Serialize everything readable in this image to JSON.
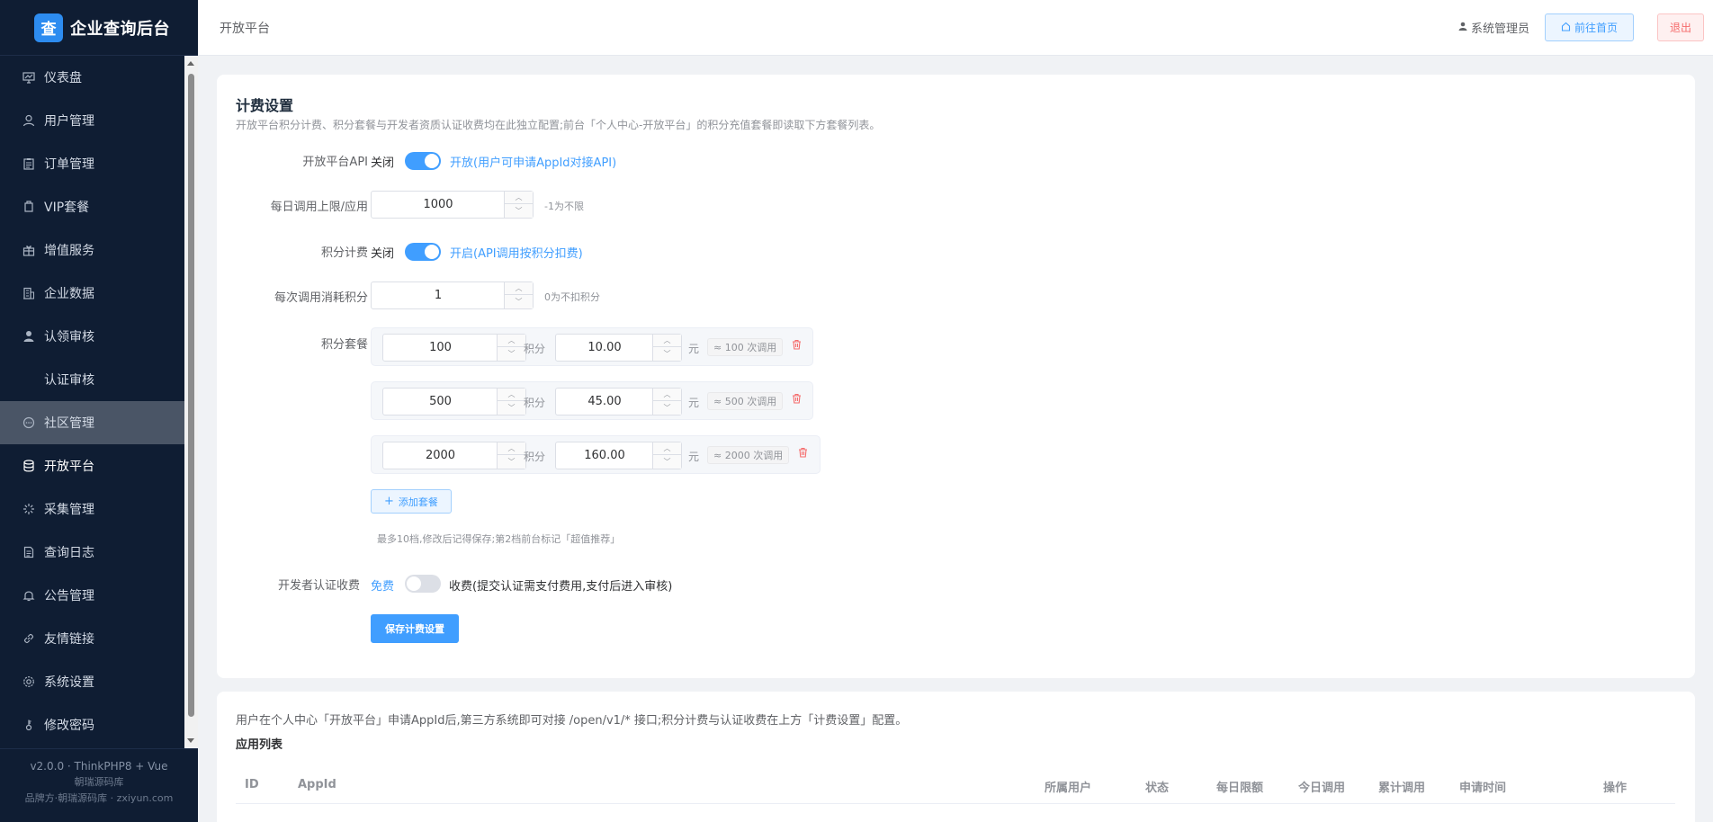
{
  "sidebar": {
    "brand_logo": "查",
    "brand_title": "企业查询后台",
    "items": [
      {
        "label": "仪表盘",
        "icon": "dashboard-icon"
      },
      {
        "label": "用户管理",
        "icon": "user-icon"
      },
      {
        "label": "订单管理",
        "icon": "order-icon"
      },
      {
        "label": "VIP套餐",
        "icon": "vip-icon"
      },
      {
        "label": "增值服务",
        "icon": "gift-icon"
      },
      {
        "label": "企业数据",
        "icon": "building-icon"
      },
      {
        "label": "认领审核",
        "icon": "user-check-icon"
      },
      {
        "label": "认证审核",
        "icon": ""
      },
      {
        "label": "社区管理",
        "icon": "chat-icon"
      },
      {
        "label": "开放平台",
        "icon": "database-icon"
      },
      {
        "label": "采集管理",
        "icon": "spinner-icon"
      },
      {
        "label": "查询日志",
        "icon": "document-icon"
      },
      {
        "label": "公告管理",
        "icon": "bell-icon"
      },
      {
        "label": "友情链接",
        "icon": "link-icon"
      },
      {
        "label": "系统设置",
        "icon": "gear-icon"
      },
      {
        "label": "修改密码",
        "icon": "key-icon"
      }
    ],
    "footer": {
      "version": "v2.0.0 · ThinkPHP8 + Vue",
      "line2": "朝瑞源码库",
      "line3": "品牌方·朝瑞源码库 · zxiyun.com"
    }
  },
  "header": {
    "breadcrumb": "开放平台",
    "admin": "系统管理员",
    "home_button": "前往首页",
    "exit_button": "退出"
  },
  "billing": {
    "title": "计费设置",
    "desc": "开放平台积分计费、积分套餐与开发者资质认证收费均在此独立配置;前台「个人中心-开放平台」的积分充值套餐即读取下方套餐列表。",
    "api": {
      "label": "开放平台API",
      "off": "关闭",
      "on": "开放(用户可申请AppId对接API)",
      "enabled": true
    },
    "daily_limit": {
      "label": "每日调用上限/应用",
      "value": "1000",
      "hint": "-1为不限"
    },
    "points_billing": {
      "label": "积分计费",
      "off": "关闭",
      "on": "开启(API调用按积分扣费)",
      "enabled": true
    },
    "per_call": {
      "label": "每次调用消耗积分",
      "value": "1",
      "hint": "0为不扣积分"
    },
    "packages": {
      "label": "积分套餐",
      "points_unit": "积分",
      "price_unit": "元",
      "rows": [
        {
          "points": "100",
          "price": "10.00",
          "approx": "≈ 100 次调用"
        },
        {
          "points": "500",
          "price": "45.00",
          "approx": "≈ 500 次调用"
        },
        {
          "points": "2000",
          "price": "160.00",
          "approx": "≈ 2000 次调用"
        }
      ],
      "add_button": "添加套餐",
      "note": "最多10档,修改后记得保存;第2档前台标记「超值推荐」"
    },
    "dev_cert": {
      "label": "开发者认证收费",
      "free": "免费",
      "charge": "收费(提交认证需支付费用,支付后进入审核)",
      "enabled": false
    },
    "save_button": "保存计费设置"
  },
  "apps": {
    "desc": "用户在个人中心「开放平台」申请AppId后,第三方系统即可对接 /open/v1/* 接口;积分计费与认证收费在上方「计费设置」配置。",
    "title": "应用列表",
    "columns": [
      "ID",
      "AppId",
      "所属用户",
      "状态",
      "每日限额",
      "今日调用",
      "累计调用",
      "申请时间",
      "操作"
    ]
  }
}
